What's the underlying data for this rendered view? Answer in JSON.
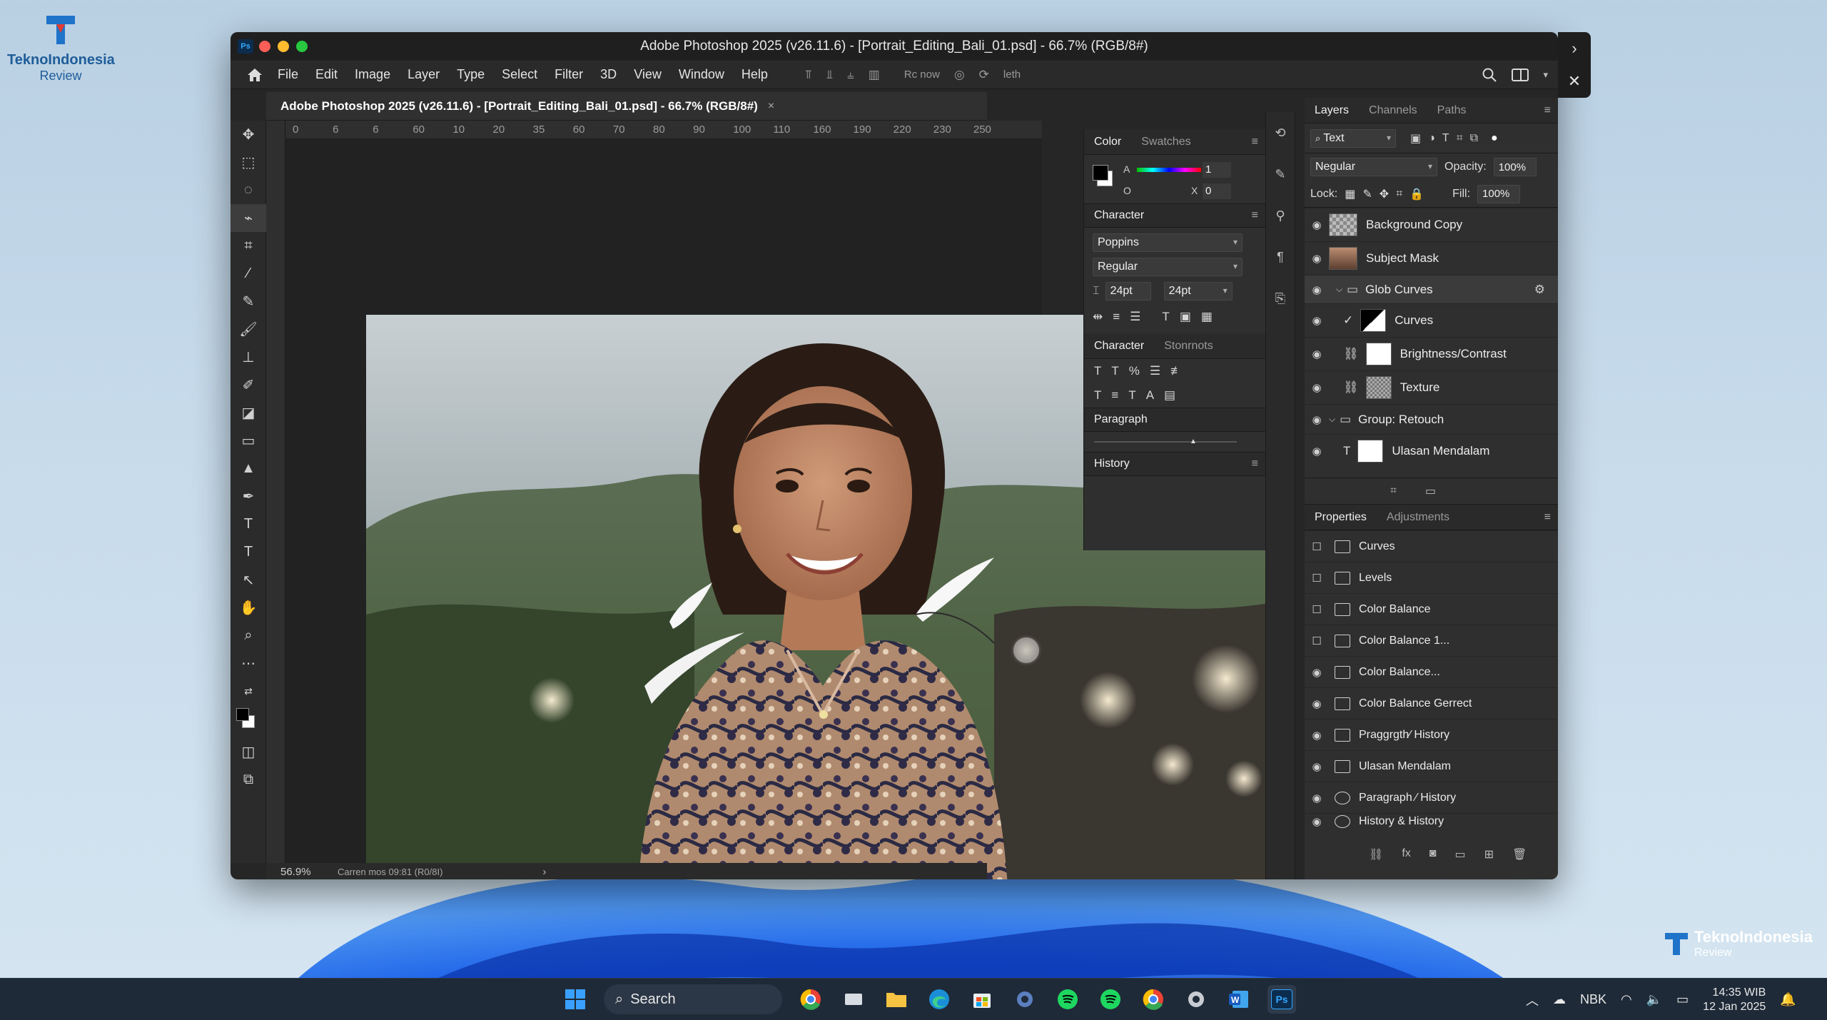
{
  "branding": {
    "name": "TeknoIndonesia",
    "tagline": "Review"
  },
  "window": {
    "title": "Adobe Photoshop 2025 (v26.11.6) - [Portrait_Editing_Bali_01.psd] - 66.7% (RGB/8#)",
    "badge": "Ps"
  },
  "menu": [
    "File",
    "Edit",
    "Image",
    "Layer",
    "Type",
    "Select",
    "Filter",
    "3D",
    "View",
    "Window",
    "Help"
  ],
  "options_bar": {
    "label_a": "Rc now",
    "label_b": "leth"
  },
  "document_tab": {
    "title": "Adobe Photoshop 2025 (v26.11.6) - [Portrait_Editing_Bali_01.psd] - 66.7% (RGB/8#)",
    "close": "×"
  },
  "ruler_h": [
    "0",
    "6",
    "6",
    "60",
    "10",
    "20",
    "35",
    "60",
    "70",
    "80",
    "90",
    "100",
    "110",
    "160",
    "190",
    "220",
    "230",
    "250"
  ],
  "color_panel": {
    "tabs": [
      "Color",
      "Swatches"
    ],
    "label_a": "A",
    "value_a": "1",
    "label_o": "O",
    "label_x": "X",
    "value_x": "0"
  },
  "character_panel": {
    "title": "Character",
    "font_family": "Poppins",
    "font_style": "Regular",
    "size": "24pt",
    "leading": "24pt"
  },
  "character_panel_2": {
    "tabs": [
      "Character",
      "Stonrnots"
    ]
  },
  "paragraph_panel": {
    "title": "Paragraph"
  },
  "history_panel": {
    "title": "History"
  },
  "layers_panel": {
    "tabs": [
      "Layers",
      "Channels",
      "Paths"
    ],
    "filter": "Text",
    "blend_mode": "Negular",
    "opacity_label": "Opacity:",
    "opacity": "100%",
    "lock_label": "Lock:",
    "fill_label": "Fill:",
    "fill": "100%",
    "layers": [
      {
        "name": "Background Copy"
      },
      {
        "name": "Subject Mask"
      },
      {
        "name": "Glob Curves"
      },
      {
        "name": "Curves"
      },
      {
        "name": "Brightness/Contrast"
      },
      {
        "name": "Texture"
      },
      {
        "name": "Group: Retouch"
      },
      {
        "name": "Ulasan Mendalam"
      }
    ]
  },
  "properties_panel": {
    "tabs": [
      "Properties",
      "Adjustments"
    ],
    "items": [
      "Curves",
      "Levels",
      "Color Balance",
      "Color Balance 1...",
      "Color Balance...",
      "Color Balance Gerrect",
      "Praggrgth⁄ History",
      "Ulasan Mendalam",
      "Paragraph ⁄ History",
      "History & History"
    ]
  },
  "status": {
    "zoom": "56.9%",
    "info": "Carren mos 09:81 (R0/8I)"
  },
  "taskbar": {
    "search_label": "Search",
    "lang": "NBK",
    "time": "14:35 WIB",
    "date": "12 Jan 2025",
    "ps_label": "Ps"
  },
  "colors": {
    "accent": "#31a8ff",
    "panel": "#2f2f2f",
    "ui_dark": "#1f1f1f"
  }
}
